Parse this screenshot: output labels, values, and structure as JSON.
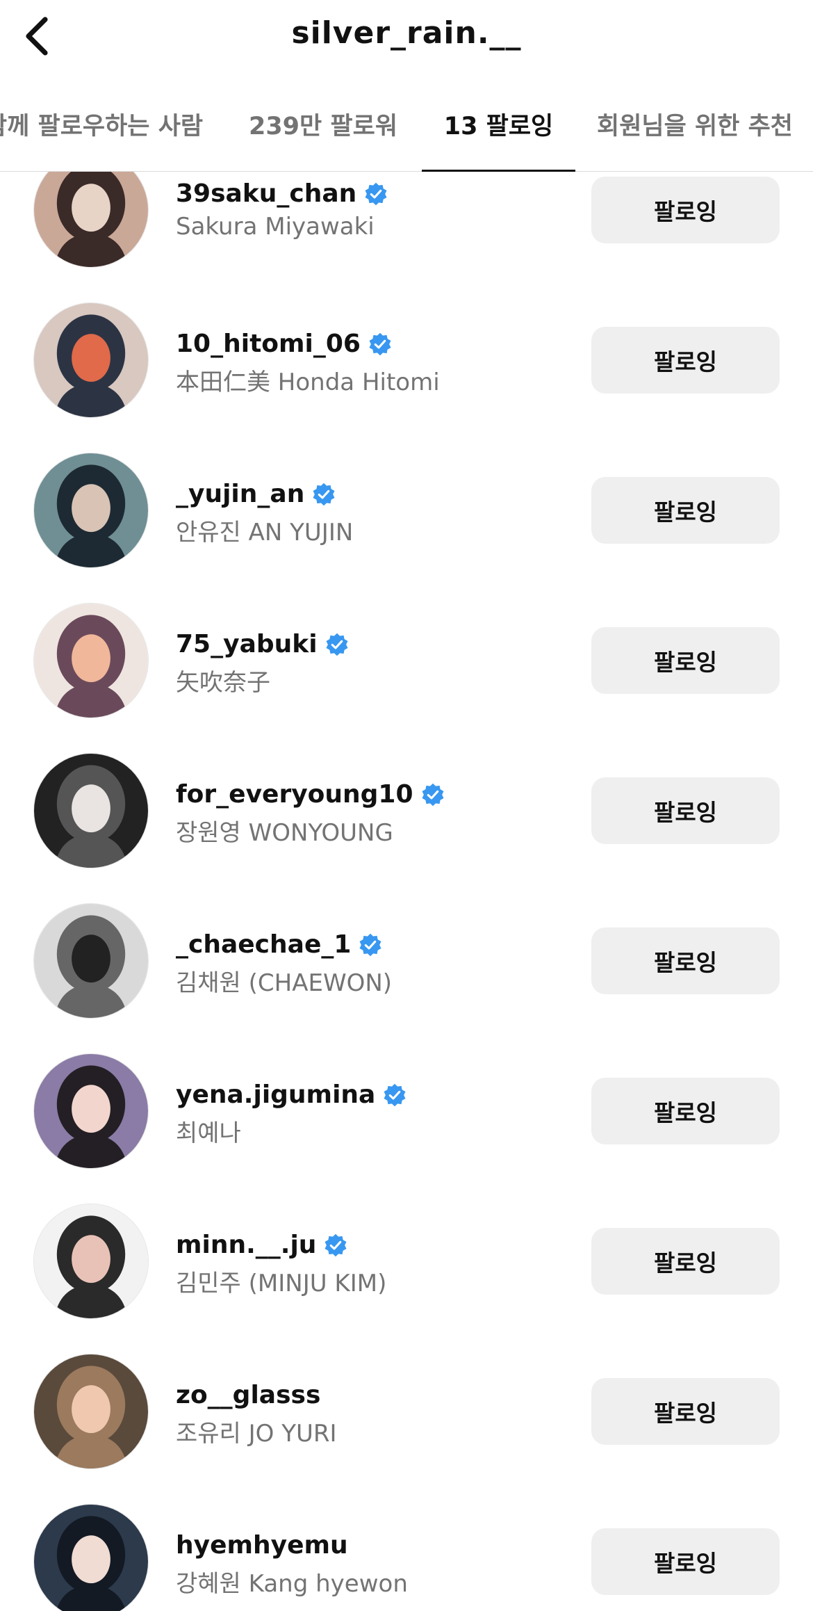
{
  "header": {
    "title": "silver_rain.__",
    "back_icon": "chevron-left-icon"
  },
  "tabs": [
    {
      "label": "함께 팔로우하는 사람",
      "active": false
    },
    {
      "label": "239만 팔로워",
      "active": false
    },
    {
      "label": "13 팔로잉",
      "active": true
    },
    {
      "label": "회원님을 위한 추천",
      "active": false
    }
  ],
  "colors": {
    "verified_badge": "#3897f0",
    "button_bg": "#efefef",
    "secondary_text": "#737373"
  },
  "following": [
    {
      "username": "39saku_chan",
      "full_name": "Sakura Miyawaki",
      "verified": true,
      "button_label": "팔로잉"
    },
    {
      "username": "10_hitomi_06",
      "full_name": "本田仁美 Honda Hitomi",
      "verified": true,
      "button_label": "팔로잉"
    },
    {
      "username": "_yujin_an",
      "full_name": "안유진 AN YUJIN",
      "verified": true,
      "button_label": "팔로잉"
    },
    {
      "username": "75_yabuki",
      "full_name": "矢吹奈子",
      "verified": true,
      "button_label": "팔로잉"
    },
    {
      "username": "for_everyoung10",
      "full_name": "장원영 WONYOUNG",
      "verified": true,
      "button_label": "팔로잉"
    },
    {
      "username": "_chaechae_1",
      "full_name": "김채원 (CHAEWON)",
      "verified": true,
      "button_label": "팔로잉"
    },
    {
      "username": "yena.jigumina",
      "full_name": "최예나",
      "verified": true,
      "button_label": "팔로잉"
    },
    {
      "username": "minn.__.ju",
      "full_name": "김민주 (MINJU KIM)",
      "verified": true,
      "button_label": "팔로잉"
    },
    {
      "username": "zo__glasss",
      "full_name": "조유리 JO YURI",
      "verified": false,
      "button_label": "팔로잉"
    },
    {
      "username": "hyemhyemu",
      "full_name": "강혜원 Kang hyewon",
      "verified": false,
      "button_label": "팔로잉"
    }
  ]
}
